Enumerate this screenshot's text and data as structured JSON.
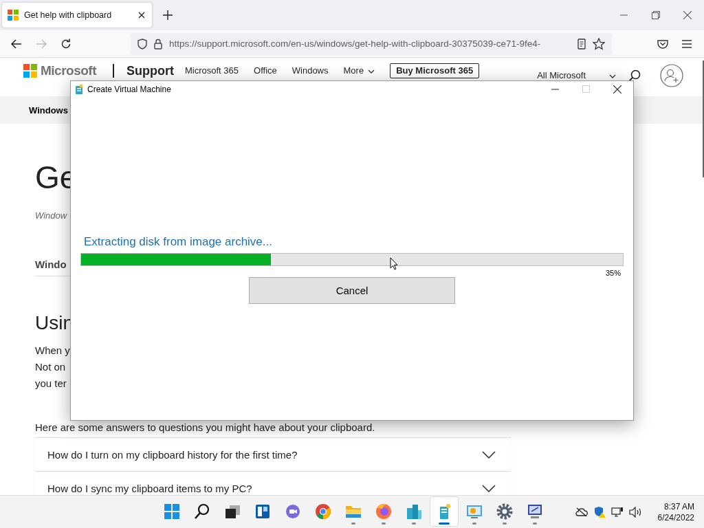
{
  "browser": {
    "tabs": [
      {
        "title": "Get help with clipboard",
        "selected": true
      }
    ],
    "url": "https://support.microsoft.com/en-us/windows/get-help-with-clipboard-30375039-ce71-9fe4-"
  },
  "site_header": {
    "logo": "Microsoft",
    "section": "Support",
    "nav": [
      "Microsoft 365",
      "Office",
      "Windows",
      "More"
    ],
    "buy_button": "Buy Microsoft 365",
    "all_microsoft": "All Microsoft"
  },
  "subnav": [
    "Windows"
  ],
  "article": {
    "title": "Ge",
    "applies_to": "Window",
    "tab": "Windo",
    "heading": "Usin",
    "paragraph_lines": [
      "When y",
      "Not on",
      "you ter"
    ],
    "intro": "Here are some answers to questions you might have about your clipboard.",
    "faq": [
      {
        "question": "How do I turn on my clipboard history for the first time?",
        "expanded": false
      },
      {
        "question": "How do I sync my clipboard items to my PC?",
        "expanded": false
      }
    ]
  },
  "dialog": {
    "title": "Create Virtual Machine",
    "maximize_enabled": false,
    "status": "Extracting disk from image archive...",
    "progress": {
      "level": 0.35,
      "reading": "35%"
    },
    "cancel": "Cancel"
  },
  "taskbar": {
    "apps": [
      {
        "kind": "start",
        "running": false,
        "selected": false
      },
      {
        "kind": "search",
        "running": false,
        "selected": false
      },
      {
        "kind": "taskview",
        "running": false,
        "selected": false
      },
      {
        "kind": "widgets",
        "running": false,
        "selected": false
      },
      {
        "kind": "chat",
        "running": false,
        "selected": false
      },
      {
        "kind": "chrome",
        "running": false,
        "selected": false
      },
      {
        "kind": "folder",
        "running": true,
        "selected": false
      },
      {
        "kind": "firefox",
        "running": true,
        "selected": false
      },
      {
        "kind": "buildings",
        "running": true,
        "selected": false
      },
      {
        "kind": "vm",
        "running": true,
        "selected": true
      },
      {
        "kind": "monitor",
        "running": true,
        "selected": false
      },
      {
        "kind": "gear",
        "running": true,
        "selected": false
      },
      {
        "kind": "screen",
        "running": true,
        "selected": false
      }
    ],
    "time": "8:37 AM",
    "date": "6/24/2022"
  }
}
